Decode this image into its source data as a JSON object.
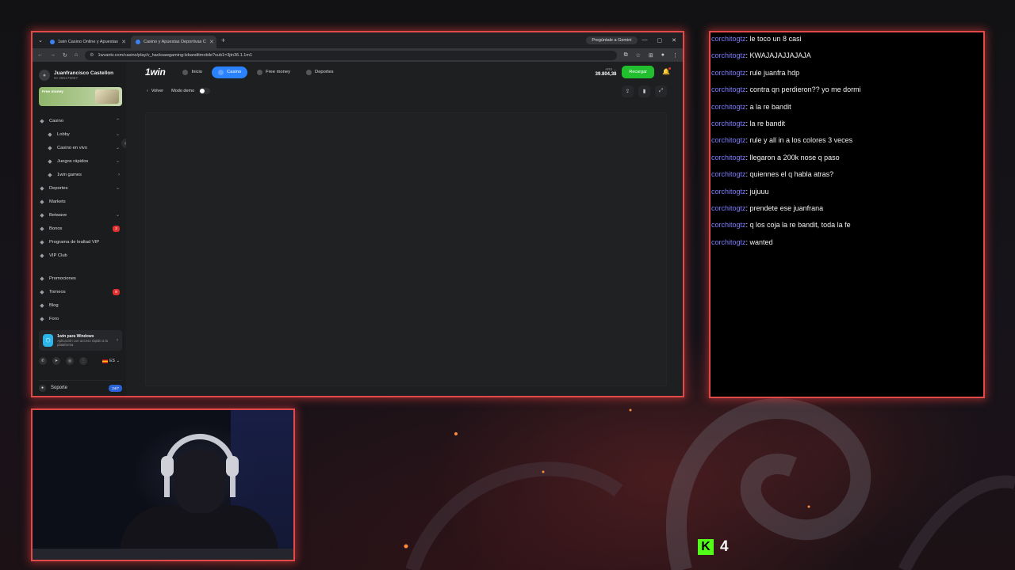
{
  "browser": {
    "tabs": [
      {
        "label": "1win Casino Online y Apuestas",
        "active": false
      },
      {
        "label": "Casino y Apuestas Deportivas C",
        "active": true
      }
    ],
    "gemini_label": "Pregúntale a Gemini",
    "url": "1wvantv.com/casino/play/v_hacksawgaming:lebanditmobile?sub1=3jtn36.1.1m1"
  },
  "sidebar": {
    "user_name": "Juanfrancisco Castellon",
    "user_id": "ID 385175967",
    "promo_text": "Free money",
    "items": [
      {
        "label": "Casino",
        "icon": "casino-icon",
        "sub": false,
        "chev": "⌃"
      },
      {
        "label": "Lobby",
        "icon": "lobby-icon",
        "sub": true,
        "chev": "⌄"
      },
      {
        "label": "Casino en vivo",
        "icon": "live-icon",
        "sub": true,
        "chev": "⌄"
      },
      {
        "label": "Juegos rápidos",
        "icon": "rocket-icon",
        "sub": true,
        "chev": "⌄"
      },
      {
        "label": "1win games",
        "icon": "games-icon",
        "sub": true,
        "chev": "›"
      },
      {
        "label": "Deportes",
        "icon": "sports-icon",
        "sub": false,
        "chev": "⌄"
      },
      {
        "label": "Markets",
        "icon": "markets-icon",
        "sub": false,
        "chev": ""
      },
      {
        "label": "Betwave",
        "icon": "betwave-icon",
        "sub": false,
        "chev": "⌄"
      },
      {
        "label": "Bonos",
        "icon": "bonus-icon",
        "sub": false,
        "badge": "2"
      },
      {
        "label": "Programa de lealtad VIP",
        "icon": "vip-program-icon",
        "sub": false,
        "chev": ""
      },
      {
        "label": "VIP Club",
        "icon": "vip-club-icon",
        "sub": false,
        "chev": ""
      }
    ],
    "items2": [
      {
        "label": "Promociones",
        "icon": "promo-icon"
      },
      {
        "label": "Torneos",
        "icon": "trophy-icon",
        "badge": "9"
      },
      {
        "label": "Blog",
        "icon": "blog-icon"
      },
      {
        "label": "Foro",
        "icon": "forum-icon"
      }
    ],
    "windows_app": {
      "title": "1win para Windows",
      "subtitle": "Aplicación con acceso rápido a la plataforma"
    },
    "language": "ES",
    "support_label": "Soporte",
    "support_badge": "24/7"
  },
  "header": {
    "brand": "1win",
    "nav": [
      {
        "label": "Inicio",
        "active": false
      },
      {
        "label": "Casino",
        "active": true
      },
      {
        "label": "Free money",
        "active": false
      },
      {
        "label": "Deportes",
        "active": false
      }
    ],
    "currency": "ARS",
    "balance": "39.804,38",
    "recargar": "Recargar"
  },
  "game": {
    "back_label": "Volver",
    "demo_label": "Modo demo"
  },
  "chat": {
    "messages": [
      {
        "user": "corchitogtz",
        "text": ": le toco un 8 casi"
      },
      {
        "user": "corchitogtz",
        "text": ": KWAJAJAJJAJAJA"
      },
      {
        "user": "corchitogtz",
        "text": ": rule juanfra hdp"
      },
      {
        "user": "corchitogtz",
        "text": ": contra qn perdieron?? yo me dormi"
      },
      {
        "user": "corchitogtz",
        "text": ": a la re bandit"
      },
      {
        "user": "corchitogtz",
        "text": ": la re bandit"
      },
      {
        "user": "corchitogtz",
        "text": ": rule y all in a los colores 3 veces"
      },
      {
        "user": "corchitogtz",
        "text": ": llegaron a 200k nose q paso"
      },
      {
        "user": "corchitogtz",
        "text": ": quiennes el q habla atras?"
      },
      {
        "user": "corchitogtz",
        "text": ": jujuuu"
      },
      {
        "user": "corchitogtz",
        "text": ": prendete ese juanfrana"
      },
      {
        "user": "corchitogtz",
        "text": ": q los coja la re bandit, toda la fe"
      },
      {
        "user": "corchitogtz",
        "text": ": wanted"
      }
    ]
  },
  "kick": {
    "viewers": "4"
  }
}
